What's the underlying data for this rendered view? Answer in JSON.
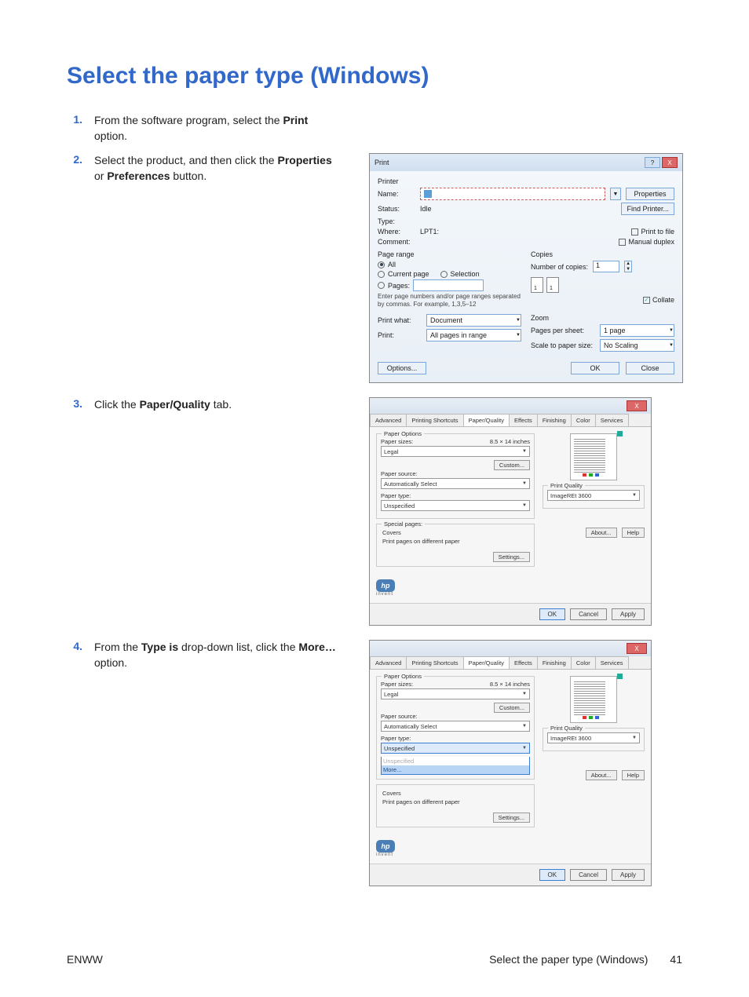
{
  "page_title": "Select the paper type (Windows)",
  "steps": [
    {
      "num": "1.",
      "pre": "From the software program, select the ",
      "bold": "Print",
      "post": " option."
    },
    {
      "num": "2.",
      "pre": "Select the product, and then click the ",
      "bold": "Properties",
      "mid": " or ",
      "bold2": "Preferences",
      "post": " button."
    },
    {
      "num": "3.",
      "pre": "Click the ",
      "bold": "Paper/Quality",
      "post": " tab."
    },
    {
      "num": "4.",
      "pre": "From the ",
      "bold": "Type is",
      "mid": " drop-down list, click the ",
      "bold2": "More…",
      "post": " option."
    }
  ],
  "print_dialog": {
    "title": "Print",
    "printer_section": "Printer",
    "name_label": "Name:",
    "status_label": "Status:",
    "status_val": "Idle",
    "type_label": "Type:",
    "where_label": "Where:",
    "where_val": "LPT1:",
    "comment_label": "Comment:",
    "properties_btn": "Properties",
    "find_printer_btn": "Find Printer...",
    "print_to_file": "Print to file",
    "manual_duplex": "Manual duplex",
    "page_range": "Page range",
    "all": "All",
    "current_page": "Current page",
    "selection": "Selection",
    "pages": "Pages:",
    "pages_hint": "Enter page numbers and/or page ranges separated by commas. For example, 1,3,5–12",
    "copies": "Copies",
    "num_copies_label": "Number of copies:",
    "num_copies_val": "1",
    "collate": "Collate",
    "print_what_label": "Print what:",
    "print_what_val": "Document",
    "print_label": "Print:",
    "print_val": "All pages in range",
    "zoom": "Zoom",
    "pps_label": "Pages per sheet:",
    "pps_val": "1 page",
    "scale_label": "Scale to paper size:",
    "scale_val": "No Scaling",
    "options_btn": "Options...",
    "ok_btn": "OK",
    "close_btn": "Close"
  },
  "prop": {
    "tabs": [
      "Advanced",
      "Printing Shortcuts",
      "Paper/Quality",
      "Effects",
      "Finishing",
      "Color",
      "Services"
    ],
    "paper_options": "Paper Options",
    "paper_sizes": "Paper sizes:",
    "paper_size_dim": "8.5 × 14 inches",
    "paper_size_val": "Legal",
    "custom_btn": "Custom...",
    "paper_source": "Paper source:",
    "paper_source_val": "Automatically Select",
    "paper_type": "Paper type:",
    "paper_type_val": "Unspecified",
    "more_item": "More...",
    "special_pages": "Special pages:",
    "covers": "Covers",
    "diff_paper": "Print pages on different paper",
    "settings_btn": "Settings...",
    "print_quality": "Print Quality",
    "pq_val": "ImageREt 3600",
    "about_btn": "About...",
    "help_btn": "Help",
    "ok": "OK",
    "cancel": "Cancel",
    "apply": "Apply",
    "logo": "hp",
    "logo_sub": "invent"
  },
  "footer": {
    "left": "ENWW",
    "center": "Select the paper type (Windows)",
    "page": "41"
  }
}
